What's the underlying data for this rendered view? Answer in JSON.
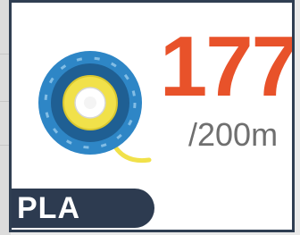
{
  "filament": {
    "remaining": "177",
    "total": "/200m",
    "material": "PLA"
  },
  "icons": {
    "spool": "filament-spool-icon"
  },
  "colors": {
    "value": "#e8522a",
    "total": "#6f6f6f",
    "border": "#2f3e52",
    "badge": "#2d3b50",
    "spool_outer": "#2e86c6",
    "spool_ring": "#1f5f93",
    "filament": "#f1e14a"
  }
}
